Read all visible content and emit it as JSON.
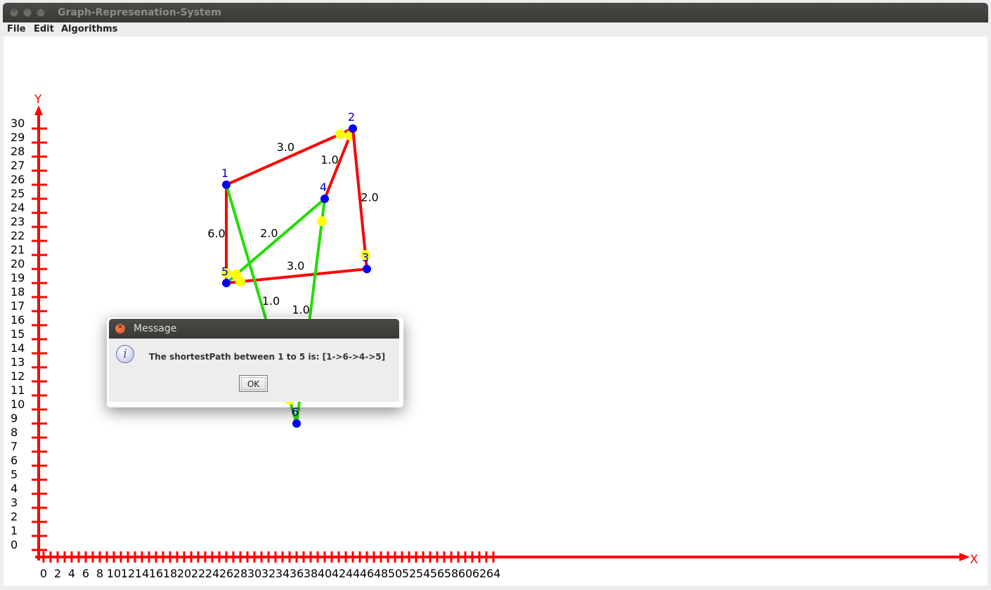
{
  "window": {
    "title": "Graph-Represenation-System"
  },
  "menu": {
    "file": "File",
    "edit": "Edit",
    "algorithms": "Algorithms"
  },
  "axes": {
    "x_label": "X",
    "y_label": "Y",
    "x_range": [
      0,
      64
    ],
    "y_range": [
      0,
      30
    ],
    "x_ticks": [
      "0",
      "2",
      "4",
      "6",
      "8",
      "10",
      "12",
      "14",
      "16",
      "18",
      "20",
      "22",
      "24",
      "26",
      "28",
      "30",
      "32",
      "34",
      "36",
      "38",
      "40",
      "42",
      "44",
      "46",
      "48",
      "50",
      "52",
      "54",
      "56",
      "58",
      "60",
      "62",
      "64"
    ],
    "y_ticks": [
      "0",
      "1",
      "2",
      "3",
      "4",
      "5",
      "6",
      "7",
      "8",
      "9",
      "10",
      "11",
      "12",
      "13",
      "14",
      "15",
      "16",
      "17",
      "18",
      "19",
      "20",
      "21",
      "22",
      "23",
      "24",
      "25",
      "26",
      "27",
      "28",
      "29",
      "30"
    ]
  },
  "graph": {
    "colors": {
      "edge": "#ff0000",
      "path": "#22dd00",
      "node": "#0000ff",
      "label": "#0000cc",
      "arrow_dot": "#ffff00",
      "axis": "#ff0000"
    },
    "nodes": [
      {
        "id": "1",
        "x": 26,
        "y": 26
      },
      {
        "id": "2",
        "x": 44,
        "y": 30
      },
      {
        "id": "3",
        "x": 46,
        "y": 20
      },
      {
        "id": "4",
        "x": 40,
        "y": 25
      },
      {
        "id": "5",
        "x": 26,
        "y": 19
      },
      {
        "id": "6",
        "x": 36,
        "y": 9
      }
    ],
    "edges": [
      {
        "from": "1",
        "to": "2",
        "weight": "3.0",
        "on_path": false
      },
      {
        "from": "4",
        "to": "2",
        "weight": "1.0",
        "on_path": false
      },
      {
        "from": "2",
        "to": "3",
        "weight": "2.0",
        "on_path": false
      },
      {
        "from": "3",
        "to": "5",
        "weight": "3.0",
        "on_path": false
      },
      {
        "from": "1",
        "to": "5",
        "weight": "6.0",
        "on_path": false
      },
      {
        "from": "1",
        "to": "6",
        "weight": "1.0",
        "on_path": true
      },
      {
        "from": "6",
        "to": "4",
        "weight": "1.0",
        "on_path": true
      },
      {
        "from": "4",
        "to": "5",
        "weight": "2.0",
        "on_path": true
      }
    ]
  },
  "dialog": {
    "title": "Message",
    "message": "The shortestPath between 1 to 5 is: [1->6->4->5]",
    "ok_label": "OK"
  }
}
